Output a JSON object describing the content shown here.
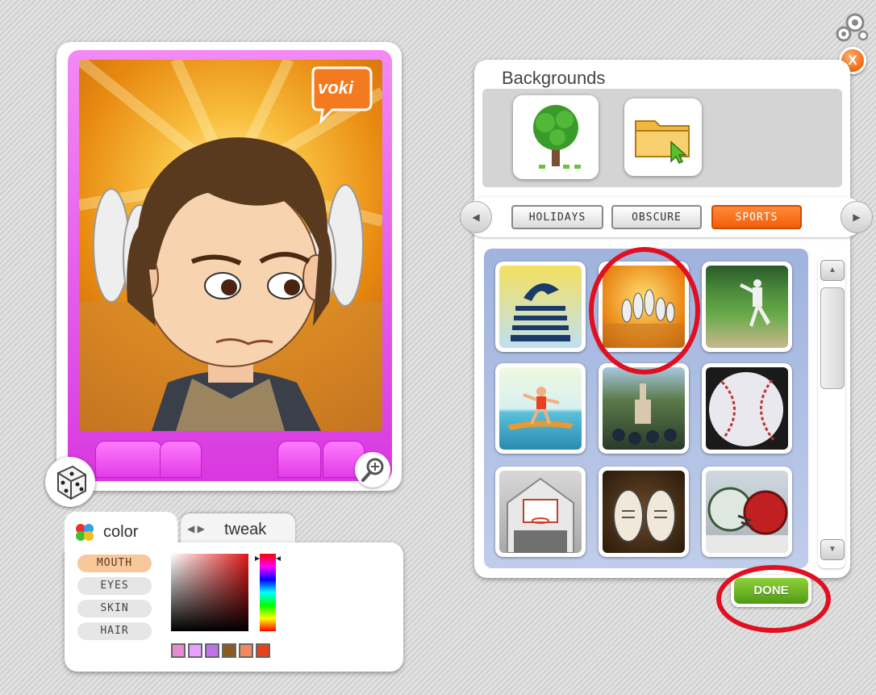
{
  "avatar": {
    "badge_text": "voki"
  },
  "color_panel": {
    "color_tab_label": "color",
    "tweak_tab_label": "tweak",
    "parts": [
      {
        "label": "MOUTH",
        "active": true
      },
      {
        "label": "EYES",
        "active": false
      },
      {
        "label": "SKIN",
        "active": false
      },
      {
        "label": "HAIR",
        "active": false
      }
    ],
    "swatch_colors": [
      "#e88ad0",
      "#e7a0ff",
      "#c070e8",
      "#8a5a20",
      "#f08860",
      "#e84018"
    ]
  },
  "backgrounds": {
    "title": "Backgrounds",
    "categories": [
      {
        "label": "HOLIDAYS",
        "active": false
      },
      {
        "label": "OBSCURE",
        "active": false
      },
      {
        "label": "SPORTS",
        "active": true
      }
    ],
    "thumbnails": [
      {
        "subject": "stairs-silhouette",
        "selected": false
      },
      {
        "subject": "bowling-pins",
        "selected": true
      },
      {
        "subject": "baseball-pitcher",
        "selected": false
      },
      {
        "subject": "surfer",
        "selected": false
      },
      {
        "subject": "cheerleaders",
        "selected": false
      },
      {
        "subject": "baseball-ball",
        "selected": false
      },
      {
        "subject": "basketball-hoop",
        "selected": false
      },
      {
        "subject": "sneakers",
        "selected": false
      },
      {
        "subject": "football-helmets",
        "selected": false
      }
    ]
  },
  "done_label": "DONE",
  "close_label": "X",
  "colors": {
    "accent_orange": "#f25e0a",
    "frame_pink": "#e23de6",
    "done_green": "#4f9a14",
    "highlight_red": "#e01020"
  }
}
